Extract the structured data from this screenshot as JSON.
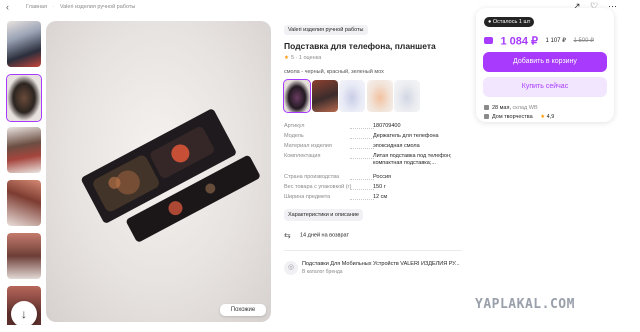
{
  "breadcrumb": {
    "items": [
      "Главная",
      "Valeri изделия ручной работы"
    ]
  },
  "brand_chip": "Valeri изделия ручной работы",
  "product": {
    "title": "Подставка для телефона, планшета",
    "rating": "5",
    "reviews": "· 1 оценка"
  },
  "colors": {
    "label": "смола - черный, красный, зеленый мох"
  },
  "specs": [
    {
      "key": "Артикул",
      "value": "180709400"
    },
    {
      "key": "Модель",
      "value": "Держатель для телефона"
    },
    {
      "key": "Материал изделия",
      "value": "эпоксидная смола"
    },
    {
      "key": "Комплектация",
      "value": "Литая подставка под телефон; компактная подставка;..."
    },
    {
      "key": "Страна производства",
      "value": "Россия"
    },
    {
      "key": "Вес товара с упаковкой (г)",
      "value": "150 г"
    },
    {
      "key": "Ширина предмета",
      "value": "12 см"
    }
  ],
  "desc_button": "Характеристики и описание",
  "return_text": "14 дней на возврат",
  "brand_card": {
    "title": "Подставки Для Мобильных Устройств VALERI ИЗДЕЛИЯ РУ...",
    "subtitle": "В каталог бренда"
  },
  "buybox": {
    "stock": "Осталось 1 шт",
    "price": "1 084 ₽",
    "price_alt": "1 107 ₽",
    "price_old": "1 500 ₽",
    "cart_button": "Добавить в корзину",
    "buy_button": "Купить сейчас",
    "delivery": "28 мая,",
    "delivery_sub": "склад WB",
    "seller": "Дом творчества",
    "seller_rating": "4,9"
  },
  "similar_button": "Похожие",
  "watermark": "YAPLAKAL.COM",
  "icons": {
    "back": "chevron-left-icon",
    "top": [
      "share-icon",
      "heart-icon",
      "more-icon"
    ],
    "scroll_down": "arrow-down-icon",
    "return": "return-arrows-icon",
    "brand": "brand-icon"
  },
  "accent_color": "#a73afd"
}
